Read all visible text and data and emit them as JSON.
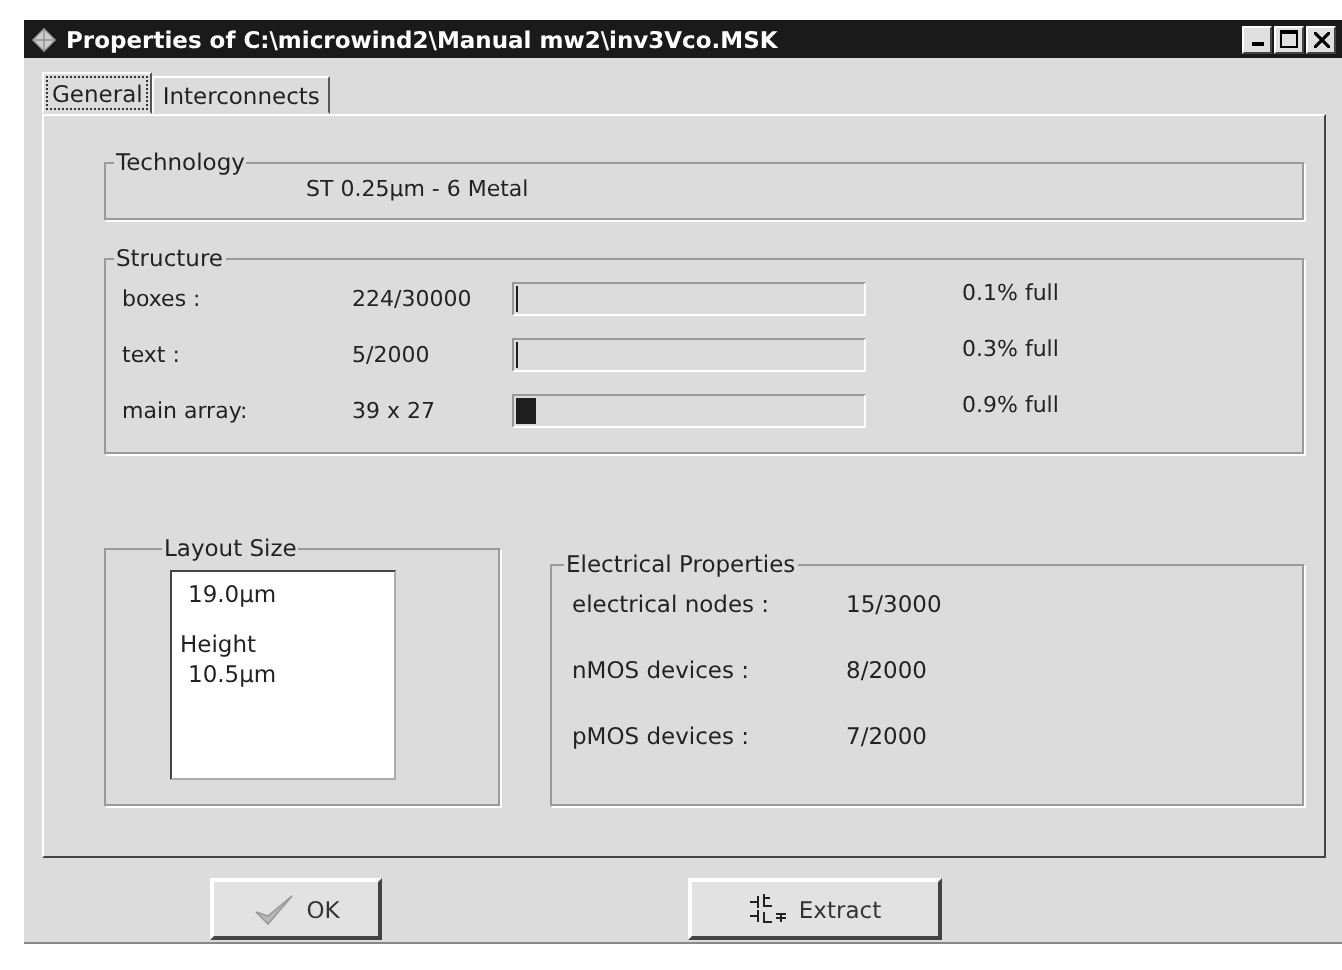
{
  "window": {
    "title": "Properties of C:\\microwind2\\Manual mw2\\inv3Vco.MSK"
  },
  "tabs": [
    {
      "label": "General",
      "selected": true
    },
    {
      "label": "Interconnects",
      "selected": false
    }
  ],
  "technology": {
    "title": "Technology",
    "value": "ST 0.25µm - 6 Metal"
  },
  "structure": {
    "title": "Structure",
    "rows": [
      {
        "label": "boxes :",
        "count": "224/30000",
        "level": 0.001,
        "reading": "0.1% full"
      },
      {
        "label": "text  :",
        "count": "5/2000",
        "level": 0.003,
        "reading": "0.3% full"
      },
      {
        "label": "main array:",
        "count": "39 x 27",
        "level": 0.06,
        "reading": "0.9% full"
      }
    ]
  },
  "layout_size": {
    "title": "Layout Size",
    "width": "19.0µm",
    "height_label": "Height",
    "height": "10.5µm"
  },
  "electrical": {
    "title": "Electrical Properties",
    "rows": [
      {
        "label": "electrical nodes :",
        "value": "15/3000"
      },
      {
        "label": "nMOS devices :",
        "value": "8/2000"
      },
      {
        "label": "pMOS devices :",
        "value": "7/2000"
      }
    ]
  },
  "buttons": [
    {
      "label": "OK",
      "kind": "ok"
    },
    {
      "label": "Extract",
      "kind": "extract"
    }
  ]
}
